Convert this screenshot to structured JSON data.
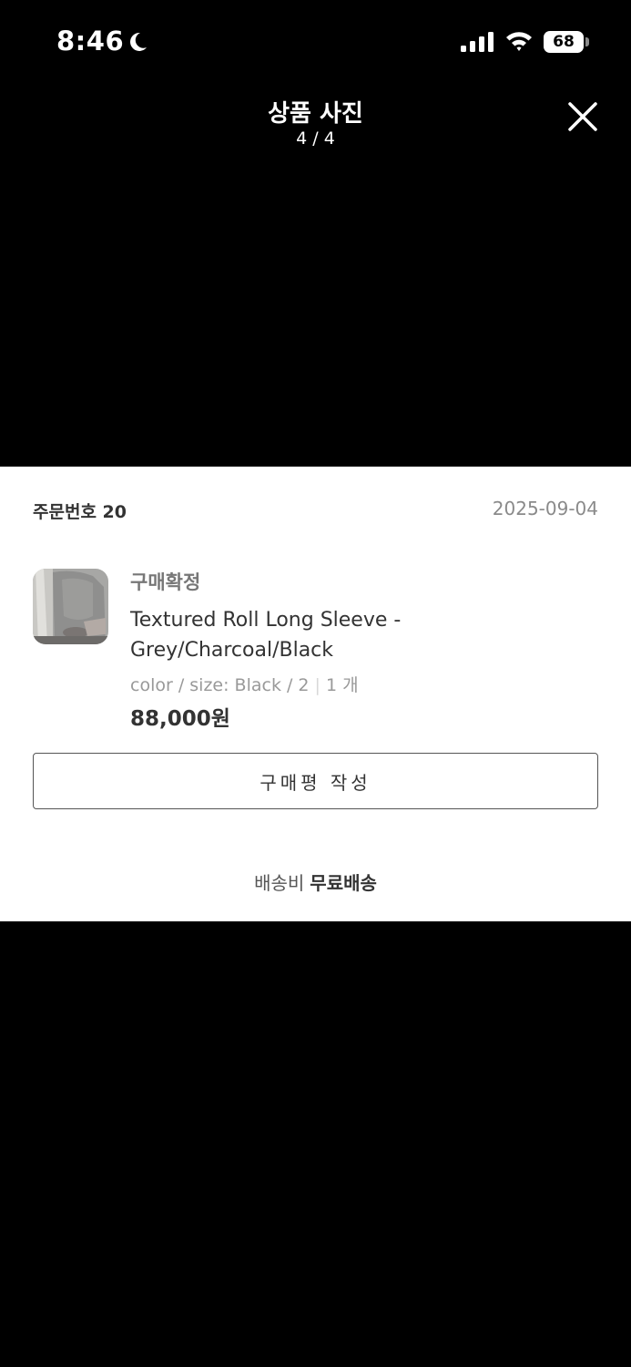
{
  "status_bar": {
    "time": "8:46",
    "battery_level": "68",
    "icons": [
      "moon-icon",
      "signal-icon",
      "wifi-icon",
      "battery-icon"
    ]
  },
  "viewer": {
    "title": "상품 사진",
    "page_indicator": "4 / 4",
    "close_icon": "close-icon"
  },
  "order": {
    "order_number_label": "주문번호 20",
    "date": "2025-09-04",
    "status": "구매확정",
    "product_name": "Textured Roll Long Sleeve - Grey/Charcoal/Black",
    "options": "color / size: Black / 2",
    "quantity": "1 개",
    "price": "88,000원",
    "review_button_label": "구매평 작성",
    "shipping_label": "배송비",
    "shipping_value": "무료배송"
  },
  "colors": {
    "background": "#000000",
    "card": "#ffffff",
    "text_primary": "#333333",
    "text_muted": "#999999"
  }
}
